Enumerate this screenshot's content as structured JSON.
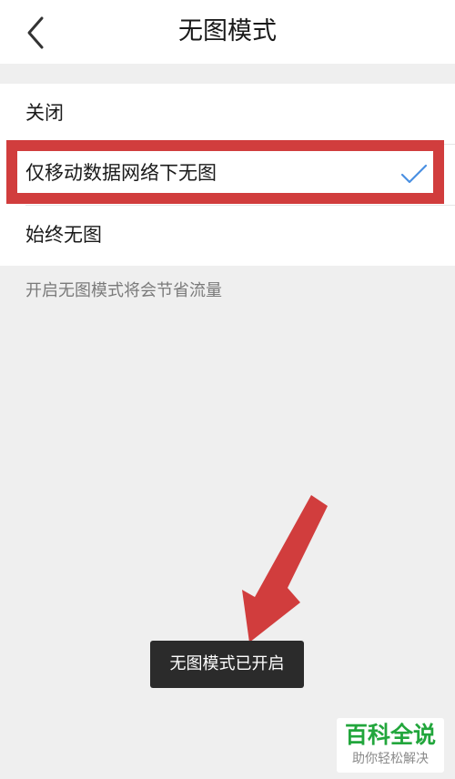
{
  "header": {
    "title": "无图模式",
    "back_icon": "chevron-left-icon"
  },
  "options": [
    {
      "label": "关闭",
      "selected": false
    },
    {
      "label": "仅移动数据网络下无图",
      "selected": true
    },
    {
      "label": "始终无图",
      "selected": false
    }
  ],
  "selected_icon": "checkmark-icon",
  "hint": "开启无图模式将会节省流量",
  "toast": "无图模式已开启",
  "watermark": {
    "main": "百科全说",
    "sub": "助你轻松解决"
  },
  "colors": {
    "accent": "#4a90e2",
    "highlight": "#d13d3d",
    "watermark_green": "#22a63c"
  }
}
